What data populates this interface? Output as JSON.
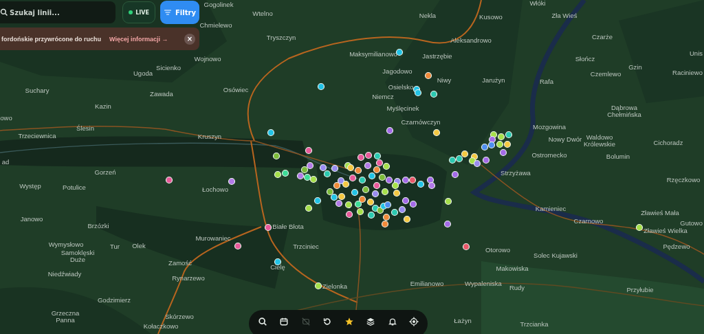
{
  "search": {
    "placeholder": "Szukaj linii..."
  },
  "live": {
    "label": "LIVE",
    "on": true
  },
  "filters": {
    "label": "Filtry",
    "selected": true
  },
  "banner": {
    "text": "fordońskie przywrócone do ruchu",
    "link": "Więcej informacji →",
    "close": "×"
  },
  "map": {
    "places": [
      "Gogolinek",
      "Wtelno",
      "Chmielewo",
      "Tryszczyn",
      "Wojnowo",
      "Sicienko",
      "Ugoda",
      "Suchary",
      "Zawada",
      "Osówiec",
      "Kazin",
      "owo",
      "Ślesin",
      "Trzeciewnica",
      "Kruszyn",
      "ad",
      "Gorzeń",
      "Występ",
      "Potulice",
      "Łochowo",
      "Janowo",
      "Brzózki",
      "Wymysłowo",
      "Tur",
      "Olek",
      "Samoklęski Duże",
      "Niedźwiady",
      "Murowaniec",
      "Białe Błota",
      "Trzciniec",
      "Zamość",
      "Cielę",
      "Rynarzewo",
      "Zielonka",
      "Godzimierz",
      "Grzeczna Panna",
      "Skórzewo",
      "Kołaczkowo",
      "Włóki",
      "Nekla",
      "Kusowo",
      "Zła Wieś",
      "Aleksandrowo",
      "Maksymilianowo",
      "Jastrzębie",
      "Jagodowo",
      "Niwy",
      "Jarużyn",
      "Rafa",
      "Czarże",
      "Słończ",
      "Gzin",
      "Czemlewo",
      "Unis",
      "Raciniewo",
      "Osielsko",
      "Niemcz",
      "Myślęcinek",
      "Czarnówczyn",
      "Dąbrowa Chełmińska",
      "Mozgowina",
      "Nowy Dwór",
      "Waldowo Królewskie",
      "Cichoradz",
      "Ostromecko",
      "Bolumin",
      "Strzyżawa",
      "Rzęczkowo",
      "Kamieniec",
      "Zławieś Mała",
      "Czarnowo",
      "Zławieś Wielka",
      "Gutowo",
      "Pędzewo",
      "Otorowo",
      "Solec Kujawski",
      "Makowiska",
      "Emilianowo",
      "Wypaleniska",
      "Rudy",
      "Przyłubie",
      "Łażyn",
      "Trzcianka"
    ],
    "vehicles": [
      {
        "color": "#22c3e6"
      },
      {
        "color": "#f08a3a"
      },
      {
        "color": "#22c3e6"
      },
      {
        "color": "#22c3e6"
      },
      {
        "color": "#2cc9b0"
      },
      {
        "color": "#22c3e6"
      },
      {
        "color": "#a46be8"
      },
      {
        "color": "#f5c842"
      },
      {
        "color": "#22c3e6"
      },
      {
        "color": "#e85a9a"
      },
      {
        "color": "#7dbb3a"
      },
      {
        "color": "#e85a9a"
      },
      {
        "color": "#b27ae8"
      },
      {
        "color": "#a6e04a"
      },
      {
        "color": "#a6e04a"
      },
      {
        "color": "#2cc9b0"
      },
      {
        "color": "#a46be8"
      },
      {
        "color": "#a6e04a"
      },
      {
        "color": "#4f8ff0"
      },
      {
        "color": "#4f8ff0"
      },
      {
        "color": "#f5c842"
      },
      {
        "color": "#f5c842"
      },
      {
        "color": "#a46be8"
      },
      {
        "color": "#2cc9b0"
      },
      {
        "color": "#2cc9b0"
      },
      {
        "color": "#f5c842"
      },
      {
        "color": "#a6e04a"
      },
      {
        "color": "#a46be8"
      },
      {
        "color": "#9a8cf0"
      },
      {
        "color": "#a46be8"
      },
      {
        "color": "#a6e04a"
      },
      {
        "color": "#a46be8"
      },
      {
        "color": "#e8586a"
      },
      {
        "color": "#e85a9a"
      },
      {
        "color": "#e85a9a"
      },
      {
        "color": "#22c3e6"
      },
      {
        "color": "#a6e04a"
      },
      {
        "color": "#a6e04a"
      },
      {
        "color": "#a6e04a"
      },
      {
        "color": "#22c3e6"
      },
      {
        "color": "#a6e04a"
      },
      {
        "color": "#3ddc97"
      },
      {
        "color": "#b27ae8"
      },
      {
        "color": "#7dbb3a"
      },
      {
        "color": "#3ddc97"
      },
      {
        "color": "#a6e04a"
      },
      {
        "color": "#b27ae8"
      },
      {
        "color": "#9a8cf0"
      },
      {
        "color": "#9a8cf0"
      },
      {
        "color": "#2cc9b0"
      },
      {
        "color": "#a6e04a"
      },
      {
        "color": "#e85a9a"
      },
      {
        "color": "#e85a9a"
      },
      {
        "color": "#2cc9b0"
      },
      {
        "color": "#e85a9a"
      },
      {
        "color": "#b27ae8"
      },
      {
        "color": "#f08a3a"
      },
      {
        "color": "#f5c842"
      },
      {
        "color": "#9a8cf0"
      },
      {
        "color": "#f08a3a"
      },
      {
        "color": "#f5c842"
      },
      {
        "color": "#e85a9a"
      },
      {
        "color": "#2cc9b0"
      },
      {
        "color": "#22c3e6"
      },
      {
        "color": "#7dbb3a"
      },
      {
        "color": "#a46be8"
      },
      {
        "color": "#9a8cf0"
      },
      {
        "color": "#a46be8"
      },
      {
        "color": "#e8586a"
      },
      {
        "color": "#22c3e6"
      },
      {
        "color": "#a46be8"
      },
      {
        "color": "#b27ae8"
      },
      {
        "color": "#22c3e6"
      },
      {
        "color": "#b27ae8"
      },
      {
        "color": "#a6e04a"
      },
      {
        "color": "#3ddc97"
      },
      {
        "color": "#a6e04a"
      },
      {
        "color": "#f08a3a"
      },
      {
        "color": "#f5c842"
      },
      {
        "color": "#2cc9b0"
      },
      {
        "color": "#7dbb3a"
      },
      {
        "color": "#22c3e6"
      },
      {
        "color": "#4f8ff0"
      },
      {
        "color": "#f5c842"
      },
      {
        "color": "#a46be8"
      },
      {
        "color": "#a46be8"
      },
      {
        "color": "#9a8cf0"
      },
      {
        "color": "#f08a3a"
      },
      {
        "color": "#2cc9b0"
      },
      {
        "color": "#f5c842"
      },
      {
        "color": "#f08a3a"
      },
      {
        "color": "#f5c842"
      },
      {
        "color": "#22c3e6"
      },
      {
        "color": "#7dbb3a"
      },
      {
        "color": "#e85a9a"
      },
      {
        "color": "#a6e04a"
      },
      {
        "color": "#a6e04a"
      },
      {
        "color": "#9a8cf0"
      },
      {
        "color": "#7dbb3a"
      },
      {
        "color": "#e85a9a"
      },
      {
        "color": "#2cc9b0"
      },
      {
        "color": "#f08a3a"
      },
      {
        "color": "#a6e04a"
      }
    ]
  },
  "toolbar": [
    {
      "kind": "search",
      "selected": false,
      "disabled": false
    },
    {
      "kind": "calendar",
      "selected": false,
      "disabled": false
    },
    {
      "kind": "hidden",
      "selected": false,
      "disabled": true
    },
    {
      "kind": "history",
      "selected": false,
      "disabled": false
    },
    {
      "kind": "favorites",
      "selected": true,
      "disabled": false
    },
    {
      "kind": "layers",
      "selected": false,
      "disabled": false
    },
    {
      "kind": "alerts",
      "selected": false,
      "disabled": false
    },
    {
      "kind": "locate",
      "selected": false,
      "disabled": false
    }
  ]
}
